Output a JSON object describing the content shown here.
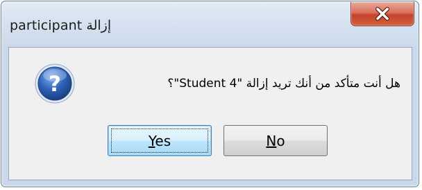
{
  "window": {
    "title": "participant إزالة"
  },
  "dialog": {
    "message": "هل أنت متأكد من أنك تريد  إزالة \"Student 4\"؟"
  },
  "buttons": {
    "yes_mnemonic": "Y",
    "yes_rest": "es",
    "no_mnemonic": "N",
    "no_rest": "o"
  },
  "icons": {
    "close": "close-icon",
    "question": "question-icon"
  },
  "colors": {
    "close_button": "#c4432b",
    "question_icon": "#2f63b8",
    "default_button_border": "#3c7fb1"
  }
}
